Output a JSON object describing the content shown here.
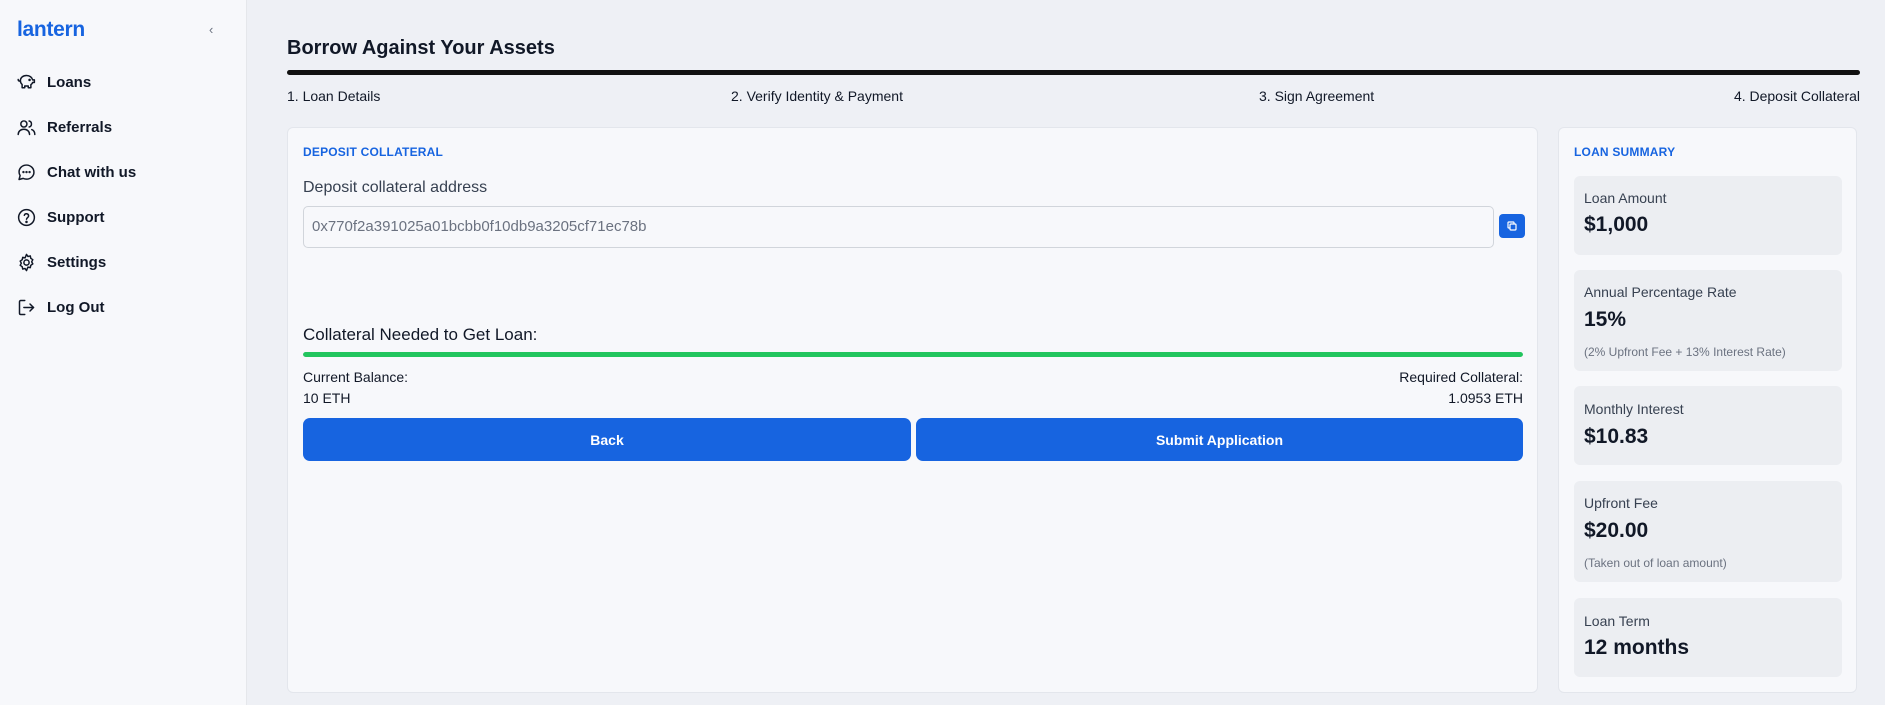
{
  "app": {
    "logo": "lantern",
    "collapse_glyph": "‹"
  },
  "sidebar": {
    "items": [
      {
        "label": "Loans",
        "icon": "piggy-bank-icon"
      },
      {
        "label": "Referrals",
        "icon": "users-icon"
      },
      {
        "label": "Chat with us",
        "icon": "chat-bubble-icon"
      },
      {
        "label": "Support",
        "icon": "help-circle-icon"
      },
      {
        "label": "Settings",
        "icon": "gear-icon"
      },
      {
        "label": "Log Out",
        "icon": "logout-icon"
      }
    ]
  },
  "page": {
    "title": "Borrow Against Your Assets",
    "steps": [
      "1. Loan Details",
      "2. Verify Identity & Payment",
      "3. Sign Agreement",
      "4. Deposit Collateral"
    ]
  },
  "deposit": {
    "section_label": "DEPOSIT COLLATERAL",
    "address_label": "Deposit collateral address",
    "address_value": "0x770f2a391025a01bcbb0f10db9a3205cf71ec78b",
    "collateral_label": "Collateral Needed to Get Loan:",
    "collateral_progress": 1.0,
    "current_balance_label": "Current Balance:",
    "current_balance_value": "10 ETH",
    "required_collateral_label": "Required Collateral:",
    "required_collateral_value": "1.0953 ETH",
    "back_label": "Back",
    "submit_label": "Submit Application"
  },
  "summary": {
    "section_label": "LOAN SUMMARY",
    "loan_amount": {
      "title": "Loan Amount",
      "value": "$1,000"
    },
    "apr": {
      "title": "Annual Percentage Rate",
      "value": "15%",
      "note": "(2% Upfront Fee + 13% Interest Rate)"
    },
    "monthly_interest": {
      "title": "Monthly Interest",
      "value": "$10.83"
    },
    "upfront_fee": {
      "title": "Upfront Fee",
      "value": "$20.00",
      "note": "(Taken out of loan amount)"
    },
    "loan_term": {
      "title": "Loan Term",
      "value": "12 months"
    }
  },
  "colors": {
    "accent": "#1764e0",
    "progress_success": "#22c55e",
    "progress_top": "#111111"
  }
}
